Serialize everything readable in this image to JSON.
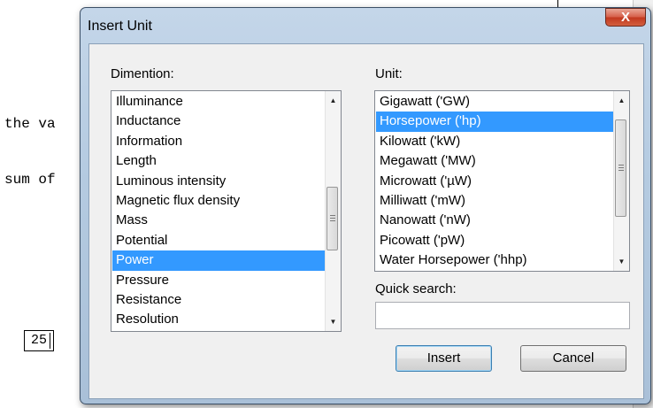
{
  "document": {
    "line1": "the va",
    "line2": "sum of",
    "field_value": "25"
  },
  "dialog": {
    "title": "Insert Unit",
    "close_label": "X",
    "dimension_label": "Dimention:",
    "unit_label": "Unit:",
    "quick_search_label": "Quick search:",
    "quick_search_value": "",
    "insert_label": "Insert",
    "cancel_label": "Cancel"
  },
  "dimensions": [
    {
      "label": "Illuminance",
      "selected": false
    },
    {
      "label": "Inductance",
      "selected": false
    },
    {
      "label": "Information",
      "selected": false
    },
    {
      "label": "Length",
      "selected": false
    },
    {
      "label": "Luminous intensity",
      "selected": false
    },
    {
      "label": "Magnetic flux density",
      "selected": false
    },
    {
      "label": "Mass",
      "selected": false
    },
    {
      "label": "Potential",
      "selected": false
    },
    {
      "label": "Power",
      "selected": true
    },
    {
      "label": "Pressure",
      "selected": false
    },
    {
      "label": "Resistance",
      "selected": false
    },
    {
      "label": "Resolution",
      "selected": false
    }
  ],
  "units": [
    {
      "label": "Gigawatt ('GW)",
      "selected": false
    },
    {
      "label": "Horsepower ('hp)",
      "selected": true
    },
    {
      "label": "Kilowatt ('kW)",
      "selected": false
    },
    {
      "label": "Megawatt ('MW)",
      "selected": false
    },
    {
      "label": "Microwatt ('µW)",
      "selected": false
    },
    {
      "label": "Milliwatt ('mW)",
      "selected": false
    },
    {
      "label": "Nanowatt ('nW)",
      "selected": false
    },
    {
      "label": "Picowatt ('pW)",
      "selected": false
    },
    {
      "label": "Water Horsepower ('hhp)",
      "selected": false
    }
  ],
  "icons": {
    "scroll_up": "▲",
    "scroll_down": "▼"
  }
}
